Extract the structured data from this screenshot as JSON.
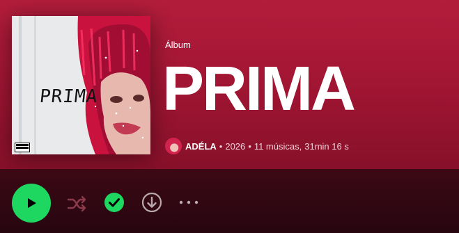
{
  "album": {
    "type_label": "Álbum",
    "title": "PRIMA",
    "cover_title": "PRIMA",
    "artist": "ADÉLA",
    "year": "2026",
    "tracks": "11 músicas,",
    "duration": "31min 16 s"
  },
  "actions": {
    "play_icon": "play-icon",
    "shuffle_icon": "shuffle-icon",
    "saved_icon": "check-circle-icon",
    "download_icon": "download-icon",
    "more_icon": "more-options-icon"
  },
  "colors": {
    "header_accent": "#b31d3c",
    "play_button": "#1ed760",
    "background": "#2a0710"
  }
}
